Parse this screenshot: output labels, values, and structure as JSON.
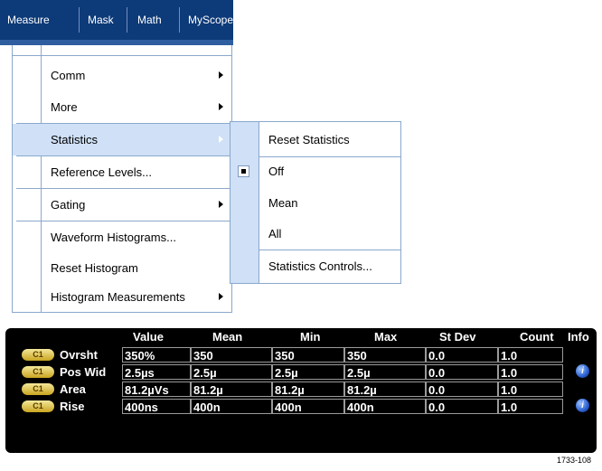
{
  "menubar": {
    "items": [
      {
        "label": "Measure"
      },
      {
        "label": "Mask"
      },
      {
        "label": "Math"
      },
      {
        "label": "MyScope"
      }
    ]
  },
  "measure_menu": {
    "items": [
      {
        "label": "Comm",
        "submenu": true
      },
      {
        "label": "More",
        "submenu": true
      },
      {
        "label": "Statistics",
        "submenu": true,
        "highlighted": true
      },
      {
        "label": "Reference Levels...",
        "submenu": false
      },
      {
        "label": "Gating",
        "submenu": true
      },
      {
        "label": "Waveform Histograms...",
        "submenu": false
      },
      {
        "label": "Reset Histogram",
        "submenu": false
      },
      {
        "label": "Histogram Measurements",
        "submenu": true
      }
    ]
  },
  "statistics_submenu": {
    "items": [
      {
        "label": "Reset Statistics"
      },
      {
        "label": "Off",
        "checked": true
      },
      {
        "label": "Mean"
      },
      {
        "label": "All"
      },
      {
        "label": "Statistics Controls..."
      }
    ]
  },
  "measurements": {
    "columns": [
      "Value",
      "Mean",
      "Min",
      "Max",
      "St Dev",
      "Count",
      "Info"
    ],
    "rows": [
      {
        "badge": "C1",
        "name": "Ovrsht",
        "value": "350%",
        "mean": "350",
        "min": "350",
        "max": "350",
        "stdev": "0.0",
        "count": "1.0",
        "info": false
      },
      {
        "badge": "C1",
        "name": "Pos Wid",
        "value": "2.5µs",
        "mean": "2.5µ",
        "min": "2.5µ",
        "max": "2.5µ",
        "stdev": "0.0",
        "count": "1.0",
        "info": true
      },
      {
        "badge": "C1",
        "name": "Area",
        "value": "81.2µVs",
        "mean": "81.2µ",
        "min": "81.2µ",
        "max": "81.2µ",
        "stdev": "0.0",
        "count": "1.0",
        "info": false
      },
      {
        "badge": "C1",
        "name": "Rise",
        "value": "400ns",
        "mean": "400n",
        "min": "400n",
        "max": "400n",
        "stdev": "0.0",
        "count": "1.0",
        "info": true
      }
    ],
    "info_icon_glyph": "i"
  },
  "figure_id": "1733-108"
}
